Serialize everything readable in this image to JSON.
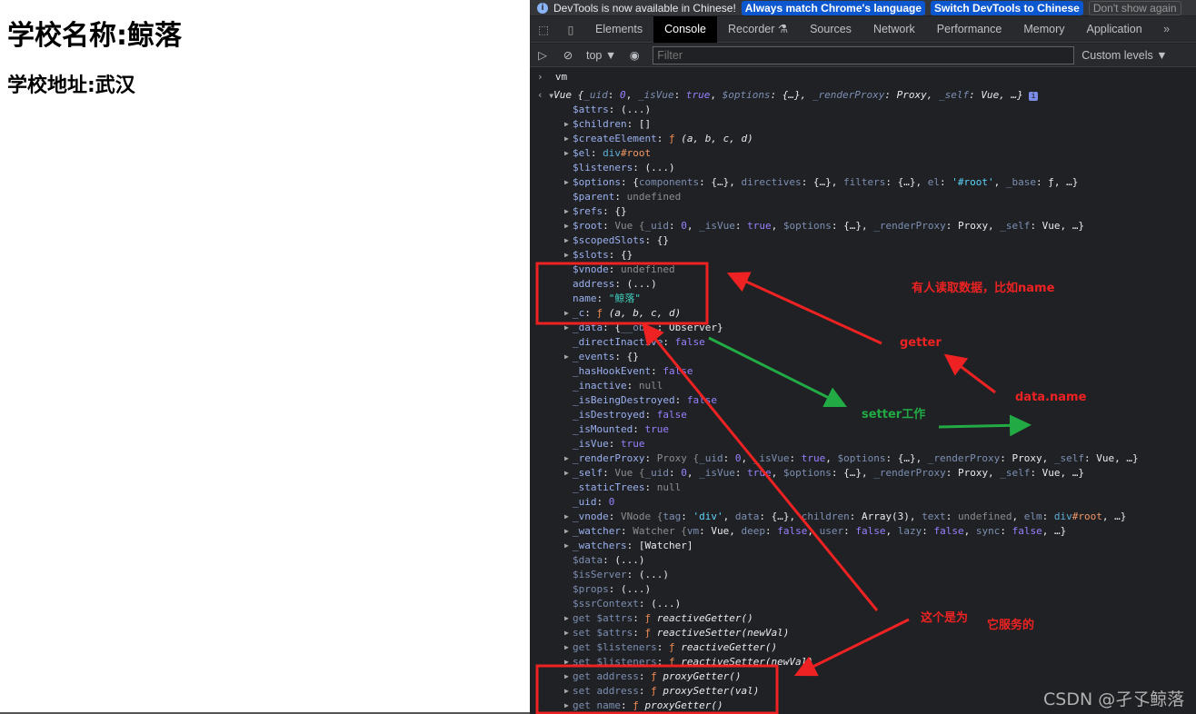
{
  "page": {
    "title": "学校名称:鲸落",
    "address": "学校地址:武汉"
  },
  "infobar": {
    "message": "DevTools is now available in Chinese!",
    "btn_match": "Always match Chrome's language",
    "btn_switch": "Switch DevTools to Chinese",
    "btn_dismiss": "Don't show again"
  },
  "tabs": [
    {
      "label": "Elements"
    },
    {
      "label": "Console",
      "active": true
    },
    {
      "label": "Recorder ⚗"
    },
    {
      "label": "Sources"
    },
    {
      "label": "Network"
    },
    {
      "label": "Performance"
    },
    {
      "label": "Memory"
    },
    {
      "label": "Application"
    }
  ],
  "toolbar": {
    "context": "top ▼",
    "filter_placeholder": "Filter",
    "levels": "Custom levels ▼"
  },
  "console": {
    "input": "vm",
    "lines": [
      {
        "exp": "open",
        "segs": [
          [
            "Vue {",
            "w it"
          ],
          [
            "_uid",
            "kd it"
          ],
          [
            ": ",
            "w"
          ],
          [
            "0",
            "b it"
          ],
          [
            ", ",
            "w"
          ],
          [
            "_isVue",
            "kd it"
          ],
          [
            ": ",
            "w"
          ],
          [
            "true",
            "b it"
          ],
          [
            ", ",
            "w"
          ],
          [
            "$options",
            "kd it"
          ],
          [
            ": {…}, ",
            "w it"
          ],
          [
            "_renderProxy",
            "kd it"
          ],
          [
            ": Proxy, ",
            "w it"
          ],
          [
            "_self",
            "kd it"
          ],
          [
            ": Vue, …}",
            "w it"
          ]
        ]
      },
      {
        "segs": [
          [
            "$attrs",
            "k"
          ],
          [
            ": (...)",
            "w"
          ]
        ]
      },
      {
        "exp": "closed",
        "segs": [
          [
            "$children",
            "k"
          ],
          [
            ": []",
            "w"
          ]
        ]
      },
      {
        "exp": "closed",
        "segs": [
          [
            "$createElement",
            "k"
          ],
          [
            ": ",
            "w"
          ],
          [
            "ƒ ",
            "f"
          ],
          [
            "(a, b, c, d)",
            "w it"
          ]
        ]
      },
      {
        "exp": "closed",
        "segs": [
          [
            "$el",
            "k"
          ],
          [
            ": ",
            "w"
          ],
          [
            "div",
            "tag"
          ],
          [
            "#root",
            "id"
          ]
        ]
      },
      {
        "segs": [
          [
            "$listeners",
            "k"
          ],
          [
            ": (...)",
            "w"
          ]
        ]
      },
      {
        "exp": "closed",
        "segs": [
          [
            "$options",
            "k"
          ],
          [
            ": {",
            "w"
          ],
          [
            "components",
            "kd"
          ],
          [
            ": {…}, ",
            "w"
          ],
          [
            "directives",
            "kd"
          ],
          [
            ": {…}, ",
            "w"
          ],
          [
            "filters",
            "kd"
          ],
          [
            ": {…}, ",
            "w"
          ],
          [
            "el",
            "kd"
          ],
          [
            ": ",
            "w"
          ],
          [
            "'#root'",
            "q"
          ],
          [
            ", ",
            "w"
          ],
          [
            "_base",
            "kd"
          ],
          [
            ": ƒ, …}",
            "w"
          ]
        ]
      },
      {
        "segs": [
          [
            "$parent",
            "k"
          ],
          [
            ": ",
            "w"
          ],
          [
            "undefined",
            "u"
          ]
        ]
      },
      {
        "exp": "closed",
        "segs": [
          [
            "$refs",
            "k"
          ],
          [
            ": {}",
            "w"
          ]
        ]
      },
      {
        "exp": "closed",
        "segs": [
          [
            "$root",
            "k"
          ],
          [
            ": ",
            "w"
          ],
          [
            "Vue {",
            "u"
          ],
          [
            "_uid",
            "kd"
          ],
          [
            ": ",
            "w"
          ],
          [
            "0",
            "b"
          ],
          [
            ", ",
            "w"
          ],
          [
            "_isVue",
            "kd"
          ],
          [
            ": ",
            "w"
          ],
          [
            "true",
            "b"
          ],
          [
            ", ",
            "w"
          ],
          [
            "$options",
            "kd"
          ],
          [
            ": {…}, ",
            "w"
          ],
          [
            "_renderProxy",
            "kd"
          ],
          [
            ": Proxy, ",
            "w"
          ],
          [
            "_self",
            "kd"
          ],
          [
            ": Vue, …}",
            "w"
          ]
        ]
      },
      {
        "exp": "closed",
        "segs": [
          [
            "$scopedSlots",
            "k"
          ],
          [
            ": {}",
            "w"
          ]
        ]
      },
      {
        "exp": "closed",
        "segs": [
          [
            "$slots",
            "k"
          ],
          [
            ": {}",
            "w"
          ]
        ]
      },
      {
        "segs": [
          [
            "$vnode",
            "k"
          ],
          [
            ": ",
            "w"
          ],
          [
            "undefined",
            "u"
          ]
        ]
      },
      {
        "segs": [
          [
            "address",
            "k"
          ],
          [
            ": (...)",
            "w"
          ]
        ]
      },
      {
        "segs": [
          [
            "name",
            "k"
          ],
          [
            ": ",
            "w"
          ],
          [
            "\"鲸落\"",
            "s"
          ]
        ]
      },
      {
        "exp": "closed",
        "segs": [
          [
            "_c",
            "k"
          ],
          [
            ": ",
            "w"
          ],
          [
            "ƒ ",
            "f"
          ],
          [
            "(a, b, c, d)",
            "w it"
          ]
        ]
      },
      {
        "exp": "closed",
        "segs": [
          [
            "_data",
            "k"
          ],
          [
            ": {",
            "w"
          ],
          [
            "__ob__",
            "kd"
          ],
          [
            ": Observer}",
            "w"
          ]
        ]
      },
      {
        "segs": [
          [
            "_directInactive",
            "k"
          ],
          [
            ": ",
            "w"
          ],
          [
            "false",
            "b"
          ]
        ]
      },
      {
        "exp": "closed",
        "segs": [
          [
            "_events",
            "k"
          ],
          [
            ": {}",
            "w"
          ]
        ]
      },
      {
        "segs": [
          [
            "_hasHookEvent",
            "k"
          ],
          [
            ": ",
            "w"
          ],
          [
            "false",
            "b"
          ]
        ]
      },
      {
        "segs": [
          [
            "_inactive",
            "k"
          ],
          [
            ": ",
            "w"
          ],
          [
            "null",
            "u"
          ]
        ]
      },
      {
        "segs": [
          [
            "_isBeingDestroyed",
            "k"
          ],
          [
            ": ",
            "w"
          ],
          [
            "false",
            "b"
          ]
        ]
      },
      {
        "segs": [
          [
            "_isDestroyed",
            "k"
          ],
          [
            ": ",
            "w"
          ],
          [
            "false",
            "b"
          ]
        ]
      },
      {
        "segs": [
          [
            "_isMounted",
            "k"
          ],
          [
            ": ",
            "w"
          ],
          [
            "true",
            "b"
          ]
        ]
      },
      {
        "segs": [
          [
            "_isVue",
            "k"
          ],
          [
            ": ",
            "w"
          ],
          [
            "true",
            "b"
          ]
        ]
      },
      {
        "exp": "closed",
        "segs": [
          [
            "_renderProxy",
            "k"
          ],
          [
            ": ",
            "w"
          ],
          [
            "Proxy {",
            "u"
          ],
          [
            "_uid",
            "kd"
          ],
          [
            ": ",
            "w"
          ],
          [
            "0",
            "b"
          ],
          [
            ", ",
            "w"
          ],
          [
            "_isVue",
            "kd"
          ],
          [
            ": ",
            "w"
          ],
          [
            "true",
            "b"
          ],
          [
            ", ",
            "w"
          ],
          [
            "$options",
            "kd"
          ],
          [
            ": {…}, ",
            "w"
          ],
          [
            "_renderProxy",
            "kd"
          ],
          [
            ": Proxy, ",
            "w"
          ],
          [
            "_self",
            "kd"
          ],
          [
            ": Vue, …}",
            "w"
          ]
        ]
      },
      {
        "exp": "closed",
        "segs": [
          [
            "_self",
            "k"
          ],
          [
            ": ",
            "w"
          ],
          [
            "Vue {",
            "u"
          ],
          [
            "_uid",
            "kd"
          ],
          [
            ": ",
            "w"
          ],
          [
            "0",
            "b"
          ],
          [
            ", ",
            "w"
          ],
          [
            "_isVue",
            "kd"
          ],
          [
            ": ",
            "w"
          ],
          [
            "true",
            "b"
          ],
          [
            ", ",
            "w"
          ],
          [
            "$options",
            "kd"
          ],
          [
            ": {…}, ",
            "w"
          ],
          [
            "_renderProxy",
            "kd"
          ],
          [
            ": Proxy, ",
            "w"
          ],
          [
            "_self",
            "kd"
          ],
          [
            ": Vue, …}",
            "w"
          ]
        ]
      },
      {
        "segs": [
          [
            "_staticTrees",
            "k"
          ],
          [
            ": ",
            "w"
          ],
          [
            "null",
            "u"
          ]
        ]
      },
      {
        "segs": [
          [
            "_uid",
            "k"
          ],
          [
            ": ",
            "w"
          ],
          [
            "0",
            "b"
          ]
        ]
      },
      {
        "exp": "closed",
        "segs": [
          [
            "_vnode",
            "k"
          ],
          [
            ": ",
            "w"
          ],
          [
            "VNode {",
            "u"
          ],
          [
            "tag",
            "kd"
          ],
          [
            ": ",
            "w"
          ],
          [
            "'div'",
            "q"
          ],
          [
            ", ",
            "w"
          ],
          [
            "data",
            "kd"
          ],
          [
            ": {…}, ",
            "w"
          ],
          [
            "children",
            "kd"
          ],
          [
            ": Array(3), ",
            "w"
          ],
          [
            "text",
            "kd"
          ],
          [
            ": ",
            "w"
          ],
          [
            "undefined",
            "u"
          ],
          [
            ", ",
            "w"
          ],
          [
            "elm",
            "kd"
          ],
          [
            ": ",
            "w"
          ],
          [
            "div",
            "tag"
          ],
          [
            "#root",
            "id"
          ],
          [
            ", …}",
            "w"
          ]
        ]
      },
      {
        "exp": "closed",
        "segs": [
          [
            "_watcher",
            "k"
          ],
          [
            ": ",
            "w"
          ],
          [
            "Watcher {",
            "u"
          ],
          [
            "vm",
            "kd"
          ],
          [
            ": Vue, ",
            "w"
          ],
          [
            "deep",
            "kd"
          ],
          [
            ": ",
            "w"
          ],
          [
            "false",
            "b"
          ],
          [
            ", ",
            "w"
          ],
          [
            "user",
            "kd"
          ],
          [
            ": ",
            "w"
          ],
          [
            "false",
            "b"
          ],
          [
            ", ",
            "w"
          ],
          [
            "lazy",
            "kd"
          ],
          [
            ": ",
            "w"
          ],
          [
            "false",
            "b"
          ],
          [
            ", ",
            "w"
          ],
          [
            "sync",
            "kd"
          ],
          [
            ": ",
            "w"
          ],
          [
            "false",
            "b"
          ],
          [
            ", …}",
            "w"
          ]
        ]
      },
      {
        "exp": "closed",
        "segs": [
          [
            "_watchers",
            "k"
          ],
          [
            ": [Watcher]",
            "w"
          ]
        ]
      },
      {
        "segs": [
          [
            "$data",
            "kd"
          ],
          [
            ": (...)",
            "w"
          ]
        ]
      },
      {
        "segs": [
          [
            "$isServer",
            "kd"
          ],
          [
            ": (...)",
            "w"
          ]
        ]
      },
      {
        "segs": [
          [
            "$props",
            "kd"
          ],
          [
            ": (...)",
            "w"
          ]
        ]
      },
      {
        "segs": [
          [
            "$ssrContext",
            "kd"
          ],
          [
            ": (...)",
            "w"
          ]
        ]
      },
      {
        "exp": "closed",
        "segs": [
          [
            "get $attrs",
            "kd"
          ],
          [
            ": ",
            "w"
          ],
          [
            "ƒ ",
            "f"
          ],
          [
            "reactiveGetter()",
            "w it"
          ]
        ]
      },
      {
        "exp": "closed",
        "segs": [
          [
            "set $attrs",
            "kd"
          ],
          [
            ": ",
            "w"
          ],
          [
            "ƒ ",
            "f"
          ],
          [
            "reactiveSetter(newVal)",
            "w it"
          ]
        ]
      },
      {
        "exp": "closed",
        "segs": [
          [
            "get $listeners",
            "kd"
          ],
          [
            ": ",
            "w"
          ],
          [
            "ƒ ",
            "f"
          ],
          [
            "reactiveGetter()",
            "w it"
          ]
        ]
      },
      {
        "exp": "closed",
        "segs": [
          [
            "set $listeners",
            "kd"
          ],
          [
            ": ",
            "w"
          ],
          [
            "ƒ ",
            "f"
          ],
          [
            "reactiveSetter(newVal)",
            "w it"
          ]
        ]
      },
      {
        "exp": "closed",
        "segs": [
          [
            "get address",
            "kd"
          ],
          [
            ": ",
            "w"
          ],
          [
            "ƒ ",
            "f"
          ],
          [
            "proxyGetter()",
            "w it"
          ]
        ]
      },
      {
        "exp": "closed",
        "segs": [
          [
            "set address",
            "kd"
          ],
          [
            ": ",
            "w"
          ],
          [
            "ƒ ",
            "f"
          ],
          [
            "proxySetter(val)",
            "w it"
          ]
        ]
      },
      {
        "exp": "closed",
        "segs": [
          [
            "get name",
            "kd"
          ],
          [
            ": ",
            "w"
          ],
          [
            "ƒ ",
            "f"
          ],
          [
            "proxyGetter()",
            "w it"
          ]
        ]
      }
    ]
  },
  "annotations": {
    "reads": "有人读取数据，比如name",
    "getter": "getter",
    "data_name": "data.name",
    "setter": "setter工作",
    "serves_a": "这个是为",
    "serves_b": "它服务的",
    "red": "#ee2222",
    "green": "#22aa44"
  },
  "watermark": "CSDN @孑孓鲸落"
}
